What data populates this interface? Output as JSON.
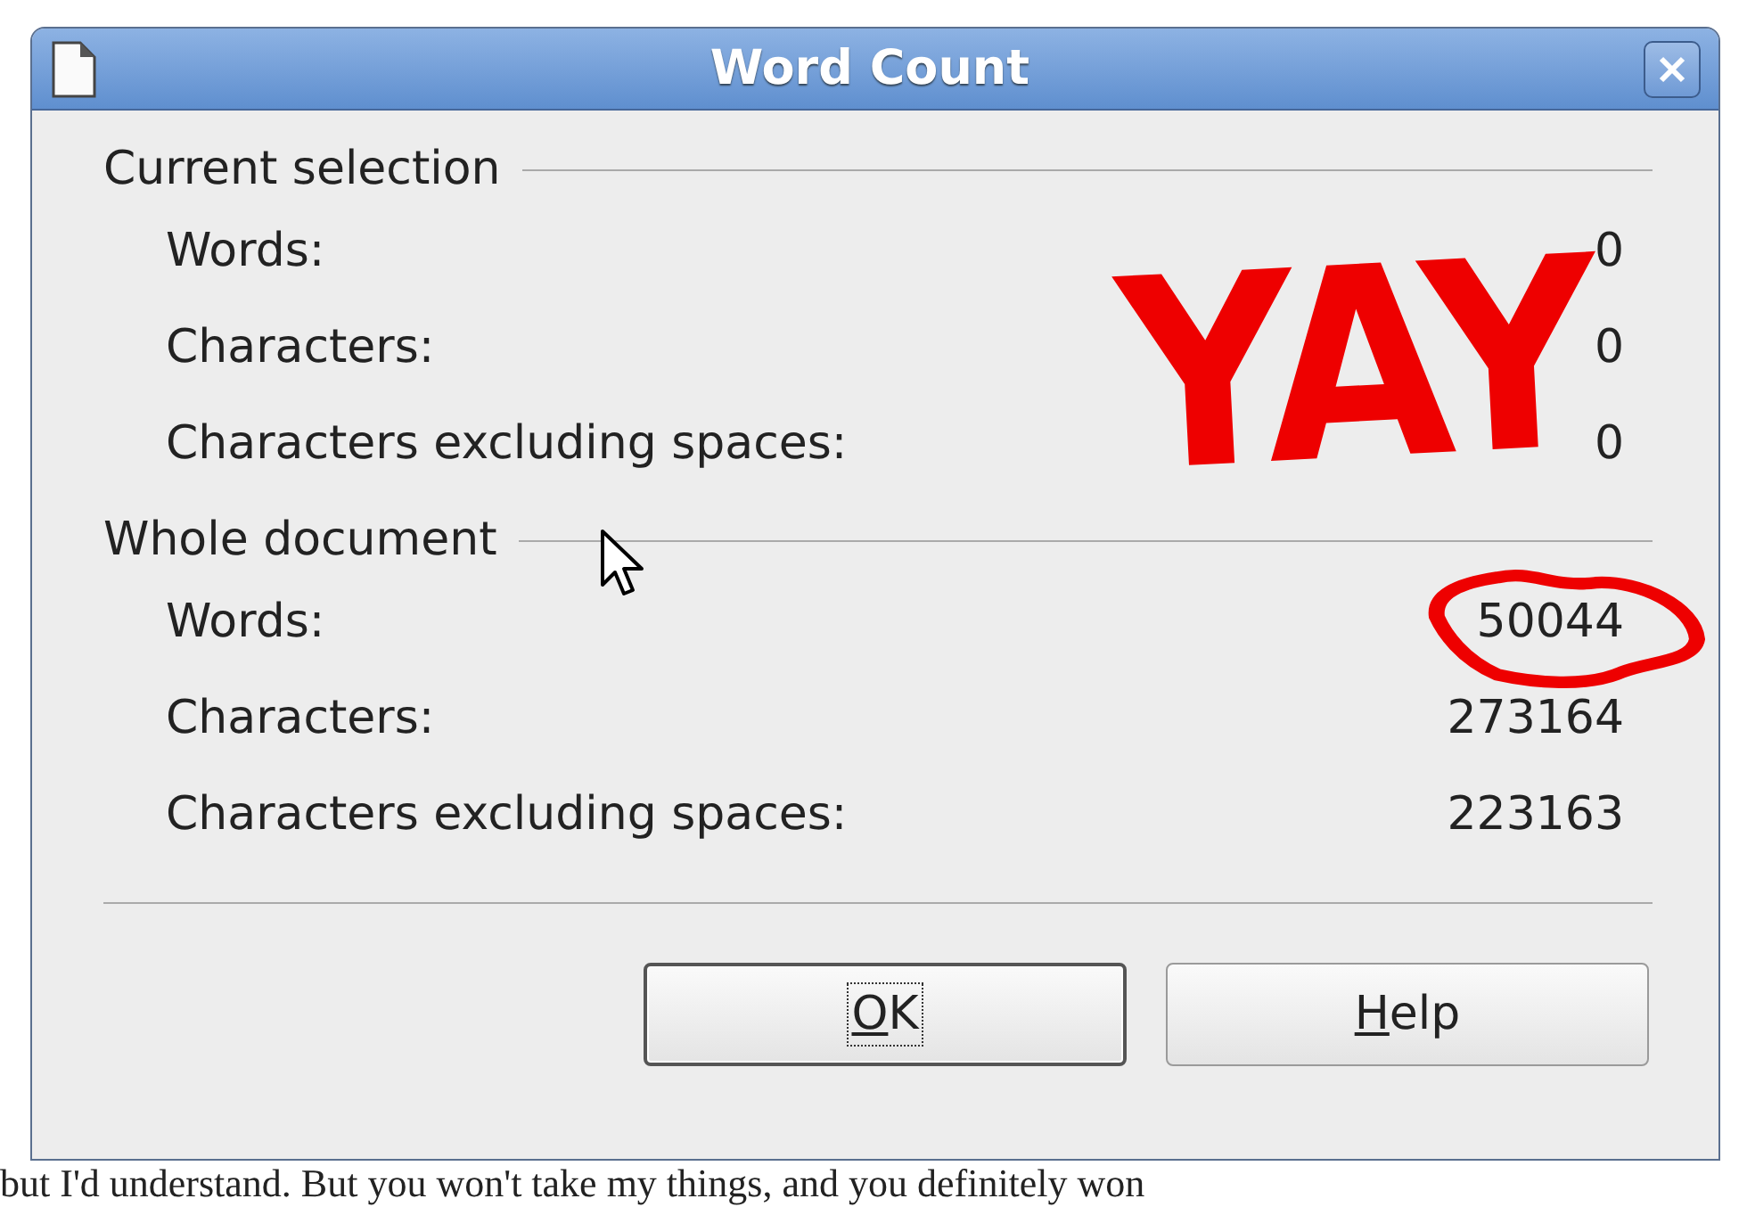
{
  "document": {
    "last_line": "but I'd understand. But you won't take my things, and you definitely won"
  },
  "window": {
    "title": "Word Count"
  },
  "sections": [
    {
      "title": "Current selection",
      "rows": [
        {
          "label": "Words:",
          "value": "0"
        },
        {
          "label": "Characters:",
          "value": "0"
        },
        {
          "label": "Characters excluding spaces:",
          "value": "0"
        }
      ]
    },
    {
      "title": "Whole document",
      "rows": [
        {
          "label": "Words:",
          "value": "50044"
        },
        {
          "label": "Characters:",
          "value": "273164"
        },
        {
          "label": "Characters excluding spaces:",
          "value": "223163"
        }
      ]
    }
  ],
  "buttons": [
    {
      "label": "OK",
      "focused": true
    },
    {
      "label": "Help",
      "focused": false
    }
  ],
  "annotation": {
    "text": "YAY"
  }
}
